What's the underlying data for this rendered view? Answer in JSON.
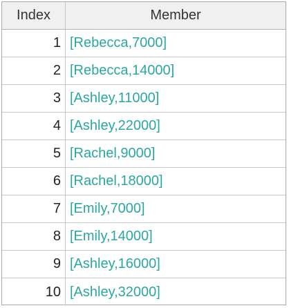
{
  "table": {
    "columns": [
      "Index",
      "Member"
    ],
    "rows": [
      {
        "index": "1",
        "member": "[Rebecca,7000]"
      },
      {
        "index": "2",
        "member": "[Rebecca,14000]"
      },
      {
        "index": "3",
        "member": "[Ashley,11000]"
      },
      {
        "index": "4",
        "member": "[Ashley,22000]"
      },
      {
        "index": "5",
        "member": "[Rachel,9000]"
      },
      {
        "index": "6",
        "member": "[Rachel,18000]"
      },
      {
        "index": "7",
        "member": "[Emily,7000]"
      },
      {
        "index": "8",
        "member": "[Emily,14000]"
      },
      {
        "index": "9",
        "member": "[Ashley,16000]"
      },
      {
        "index": "10",
        "member": "[Ashley,32000]"
      }
    ]
  },
  "colors": {
    "member_text": "#2aa7a1",
    "header_bg": "#f0f0f0",
    "grid_line": "#c8c8c8"
  }
}
